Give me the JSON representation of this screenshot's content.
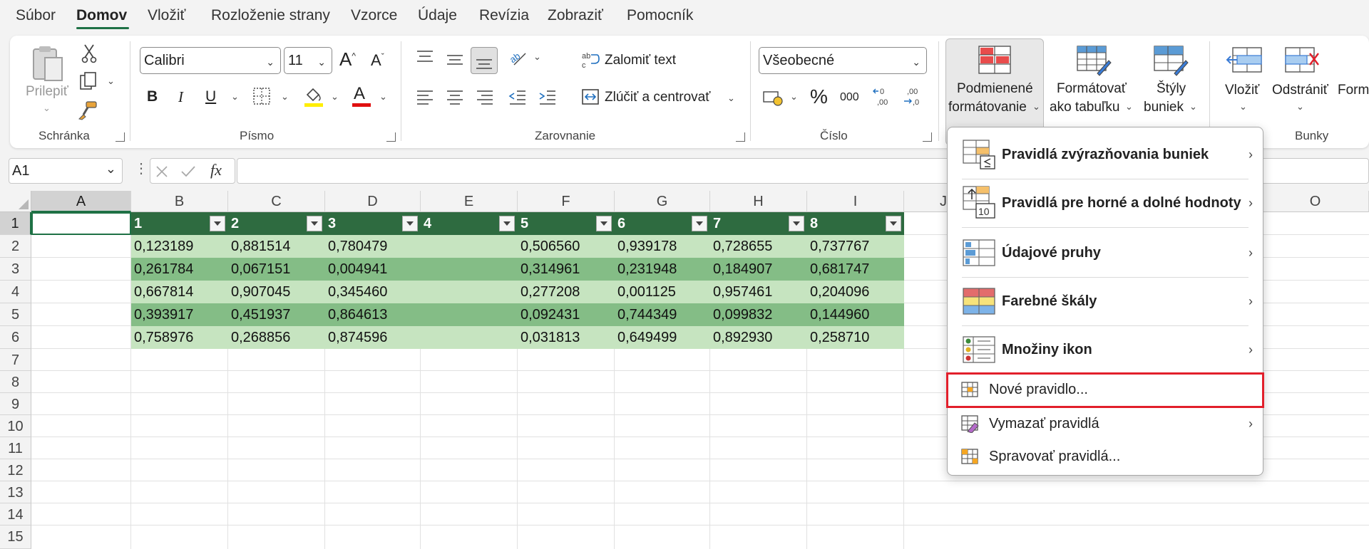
{
  "menu": {
    "tabs": [
      "Súbor",
      "Domov",
      "Vložiť",
      "Rozloženie strany",
      "Vzorce",
      "Údaje",
      "Revízia",
      "Zobraziť",
      "Pomocník"
    ]
  },
  "ribbon": {
    "clipboard": {
      "paste": "Prilepiť",
      "group": "Schránka"
    },
    "font": {
      "name": "Calibri",
      "size": "11",
      "group": "Písmo",
      "bold": "B",
      "italic": "I",
      "underline": "U",
      "grow": "A",
      "shrink": "A",
      "font_color": "A"
    },
    "alignment": {
      "wrap": "Zalomiť text",
      "merge": "Zlúčiť a centrovať",
      "group": "Zarovnanie"
    },
    "number": {
      "format": "Všeobecné",
      "percent": "%",
      "thousands": "000",
      "group": "Číslo"
    },
    "styles": {
      "cond_line1": "Podmienené",
      "cond_line2": "formátovanie",
      "table_line1": "Formátovať",
      "table_line2": "ako tabuľku",
      "cell_line1": "Štýly",
      "cell_line2": "buniek"
    },
    "cells": {
      "insert": "Vložiť",
      "delete": "Odstrániť",
      "format": "Form",
      "group": "Bunky"
    }
  },
  "formula_bar": {
    "name_box": "A1",
    "fx": "fx",
    "value": ""
  },
  "columns": [
    "A",
    "B",
    "C",
    "D",
    "E",
    "F",
    "G",
    "H",
    "I",
    "J",
    "O"
  ],
  "rows": [
    "1",
    "2",
    "3",
    "4",
    "5",
    "6",
    "7",
    "8",
    "9",
    "10",
    "11",
    "12",
    "13",
    "14",
    "15"
  ],
  "table": {
    "headers": [
      "1",
      "2",
      "3",
      "4",
      "5",
      "6",
      "7",
      "8"
    ],
    "rows": [
      [
        "0,123189",
        "0,881514",
        "0,780479",
        "",
        "0,506560",
        "0,939178",
        "0,728655",
        "0,737767"
      ],
      [
        "0,261784",
        "0,067151",
        "0,004941",
        "",
        "0,314961",
        "0,231948",
        "0,184907",
        "0,681747"
      ],
      [
        "0,667814",
        "0,907045",
        "0,345460",
        "",
        "0,277208",
        "0,001125",
        "0,957461",
        "0,204096"
      ],
      [
        "0,393917",
        "0,451937",
        "0,864613",
        "",
        "0,092431",
        "0,744349",
        "0,099832",
        "0,144960"
      ],
      [
        "0,758976",
        "0,268856",
        "0,874596",
        "",
        "0,031813",
        "0,649499",
        "0,892930",
        "0,258710"
      ]
    ]
  },
  "cf_menu": {
    "highlight_rules": "Pravidlá zvýrazňovania buniek",
    "top_bottom": "Pravidlá pre horné a dolné hodnoty",
    "data_bars": "Údajové pruhy",
    "color_scales": "Farebné škály",
    "icon_sets": "Množiny ikon",
    "new_rule": "Nové pravidlo...",
    "clear_rules": "Vymazať pravidlá",
    "manage_rules": "Spravovať pravidlá...",
    "top_bottom_badge": "10"
  },
  "colors": {
    "accent": "#1e7145",
    "table_header": "#2e6b40",
    "band_light": "#c6e4c0",
    "band_dark": "#84bd86",
    "highlight_box": "#e21f2b"
  }
}
